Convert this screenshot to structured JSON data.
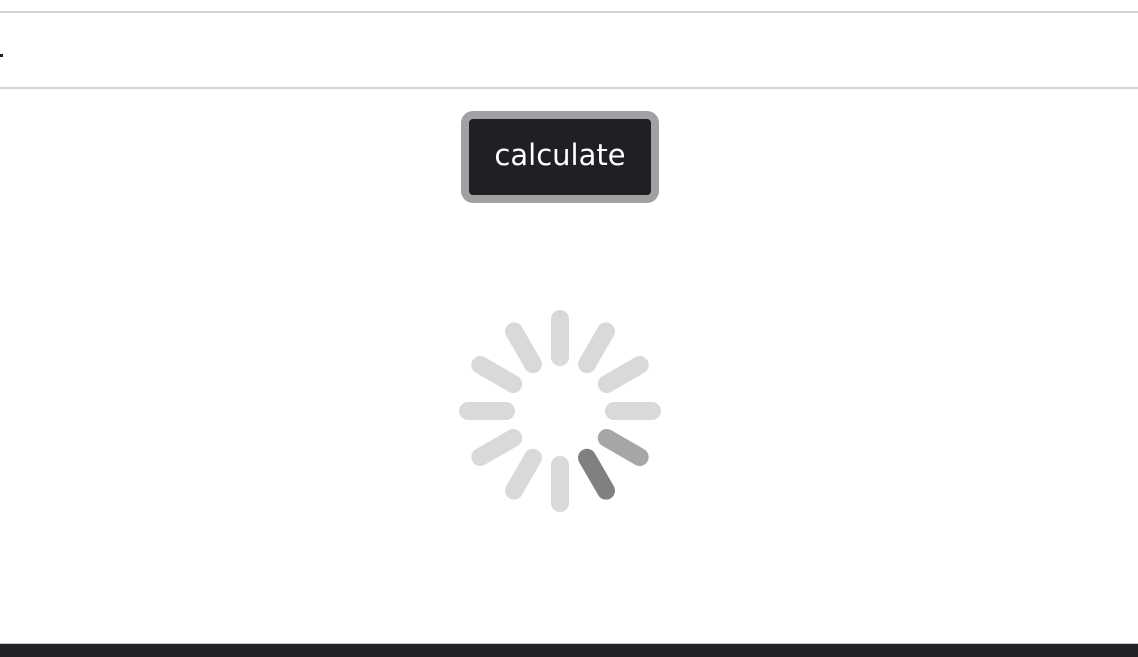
{
  "input": {
    "value": "",
    "placeholder": ""
  },
  "button": {
    "label": "calculate"
  },
  "spinner": {
    "spokes": 12,
    "base_color": "#d9d9d9",
    "active_color": "#808080",
    "trail_color": "#a6a6a6",
    "active_index": 5,
    "trail_index": 4
  },
  "colors": {
    "button_bg": "#1f2024",
    "button_border": "#a0a1a3",
    "footer": "#212328"
  }
}
